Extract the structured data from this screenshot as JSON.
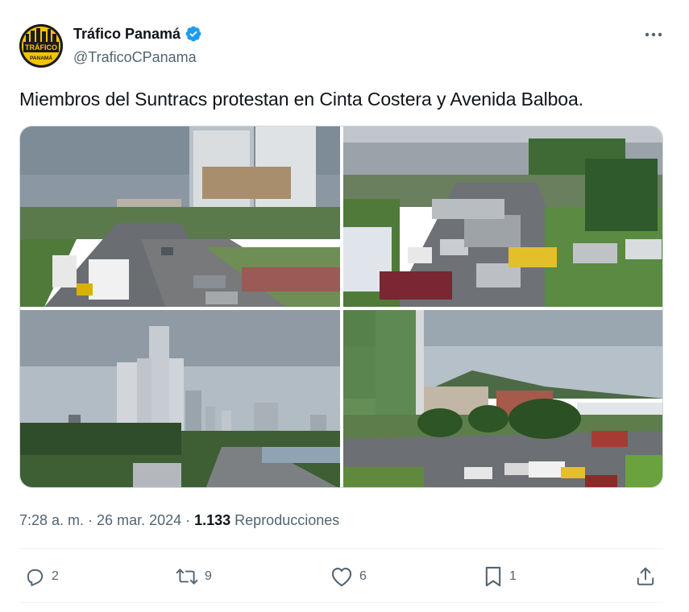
{
  "author": {
    "display_name": "Tráfico Panamá",
    "handle": "@TraficoCPanama",
    "verified": true,
    "avatar_text_top": "TRÁFICO",
    "avatar_text_bottom": "PANAMÁ",
    "verified_color": "#1d9bf0"
  },
  "tweet": {
    "text": "Miembros del Suntracs protestan en Cinta Costera y Avenida Balboa."
  },
  "media": {
    "photos": [
      {
        "name": "photo-highway-buses"
      },
      {
        "name": "photo-traffic-jam"
      },
      {
        "name": "photo-skyline"
      },
      {
        "name": "photo-avenue-trees"
      }
    ]
  },
  "meta": {
    "time": "7:28 a. m.",
    "separator": "·",
    "date": "26 mar. 2024",
    "separator2": "·",
    "views_count": "1.133",
    "views_label": "Reproducciones"
  },
  "actions": {
    "replies": "2",
    "retweets": "9",
    "likes": "6",
    "bookmarks": "1"
  },
  "icons": {
    "more": "more-horizontal-icon",
    "reply": "reply-icon",
    "retweet": "retweet-icon",
    "like": "heart-icon",
    "bookmark": "bookmark-icon",
    "share": "share-icon"
  },
  "colors": {
    "text_primary": "#0f1419",
    "text_secondary": "#536471",
    "border": "#eff3f4"
  }
}
